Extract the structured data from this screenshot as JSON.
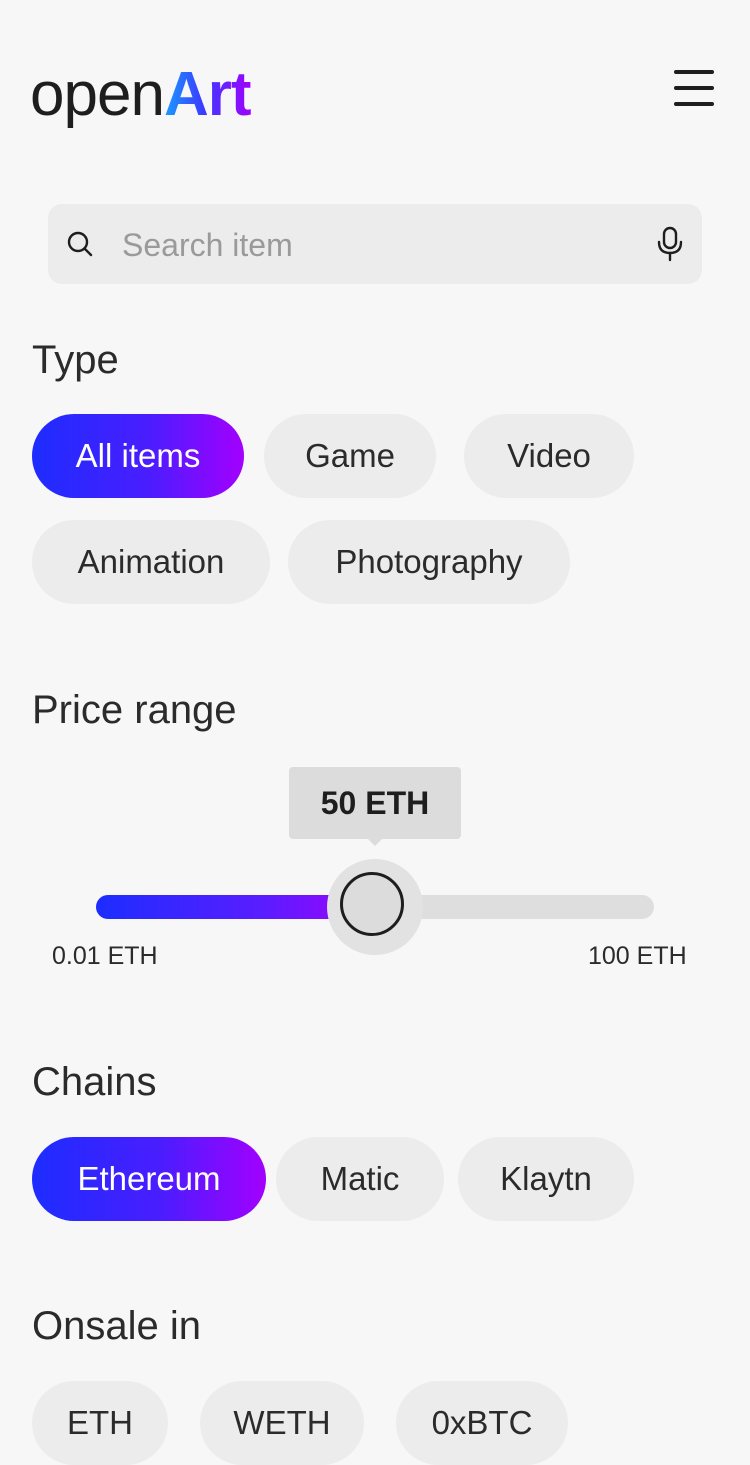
{
  "brand": {
    "logo_part1": "open",
    "logo_part2": "Art"
  },
  "header": {
    "menu_icon": "hamburger-menu-icon"
  },
  "search": {
    "placeholder": "Search item",
    "value": "",
    "icon": "search-icon",
    "mic_icon": "microphone-icon"
  },
  "type_section": {
    "title": "Type",
    "options": [
      "All items",
      "Game",
      "Video",
      "Animation",
      "Photography"
    ],
    "selected": "All items"
  },
  "price_section": {
    "title": "Price range",
    "current_label": "50 ETH",
    "current_value": 50,
    "min_label": "0.01 ETH",
    "max_label": "100 ETH",
    "min": 0.01,
    "max": 100,
    "fill_fraction": 0.5
  },
  "chains_section": {
    "title": "Chains",
    "options": [
      "Ethereum",
      "Matic",
      "Klaytn"
    ],
    "selected": "Ethereum"
  },
  "onsale_section": {
    "title": "Onsale in",
    "options": [
      "ETH",
      "WETH",
      "0xBTC"
    ]
  },
  "colors": {
    "accent_start": "#1d2dff",
    "accent_end": "#a300ff",
    "chip_bg": "#ececec",
    "background": "#f7f7f7"
  }
}
